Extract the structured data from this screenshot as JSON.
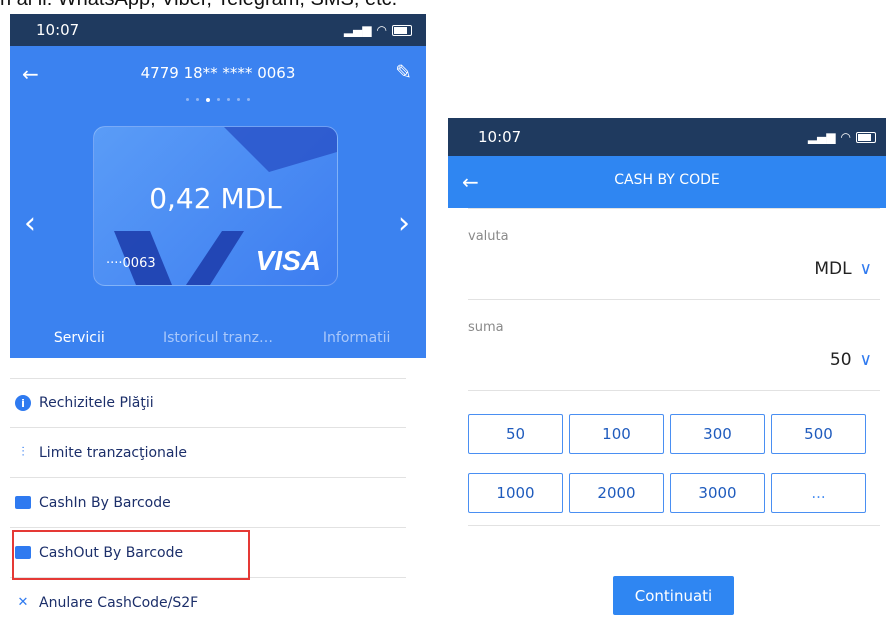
{
  "caption": "n al li: WhatsApp, Viber, Telegram, SMS, etc.",
  "left_phone": {
    "status_time": "10:07",
    "card_number": "4779 18** **** 0063",
    "balance": "0,42 MDL",
    "card_last": "····0063",
    "card_brand": "VISA",
    "page_dots": 7,
    "active_dot": 2,
    "tabs": [
      "Servicii",
      "Istoricul tranz…",
      "Informatii"
    ],
    "menu": [
      {
        "label": "Rechizitele Plăţii",
        "icon": "info-icon"
      },
      {
        "label": "Limite tranzacţionale",
        "icon": "sliders-icon"
      },
      {
        "label": "CashIn By Barcode",
        "icon": "cash-box-icon"
      },
      {
        "label": "CashOut By Barcode",
        "icon": "cash-box-icon"
      },
      {
        "label": "Anulare CashCode/S2F",
        "icon": "close-icon"
      }
    ]
  },
  "right_phone": {
    "status_time": "10:07",
    "title": "CASH BY CODE",
    "currency_label": "valuta",
    "currency_value": "MDL",
    "amount_label": "suma",
    "amount_value": "50",
    "amounts": [
      "50",
      "100",
      "300",
      "500",
      "1000",
      "2000",
      "3000",
      "..."
    ],
    "continue_label": "Continuati"
  },
  "colors": {
    "status_bar": "#1f3a5f",
    "primary_blue": "#3b82f0",
    "highlight_red": "#e53935"
  }
}
